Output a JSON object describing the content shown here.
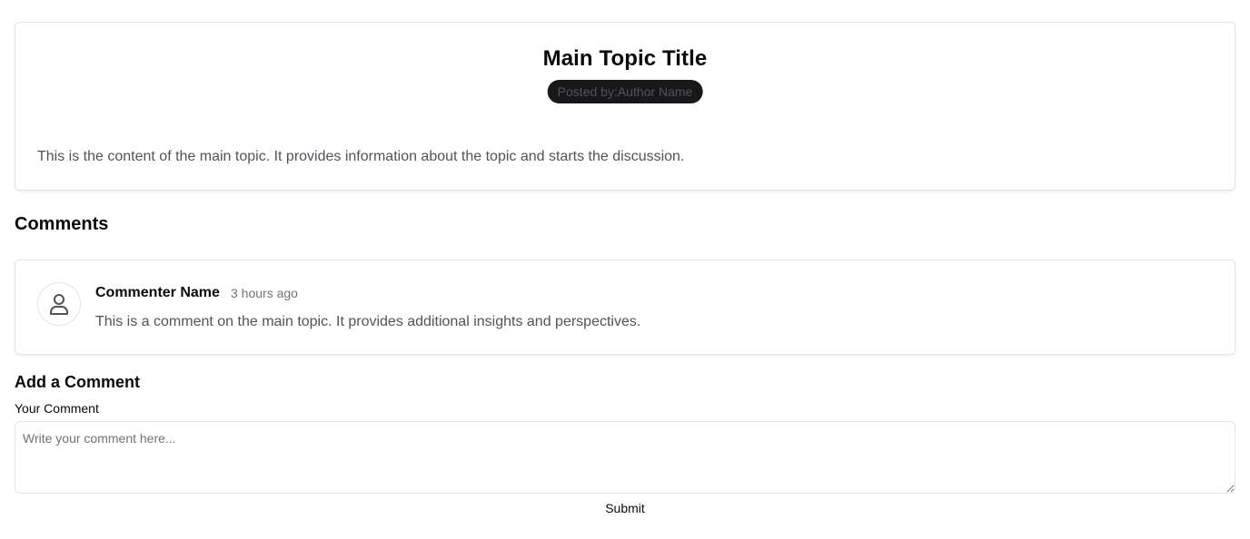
{
  "topic": {
    "title": "Main Topic Title",
    "posted_by": "Posted by:Author Name",
    "content": "This is the content of the main topic. It provides information about the topic and starts the discussion."
  },
  "comments_section": {
    "heading": "Comments",
    "items": [
      {
        "avatar_icon": "user-icon",
        "name": "Commenter Name",
        "time": "3 hours ago",
        "text": "This is a comment on the main topic. It provides additional insights and perspectives."
      }
    ]
  },
  "add_comment": {
    "heading": "Add a Comment",
    "label": "Your Comment",
    "placeholder": "Write your comment here...",
    "value": "",
    "submit_label": "Submit"
  },
  "colors": {
    "pill_background": "#18181b",
    "border": "#e4e4e7",
    "muted_text": "#52525b"
  }
}
